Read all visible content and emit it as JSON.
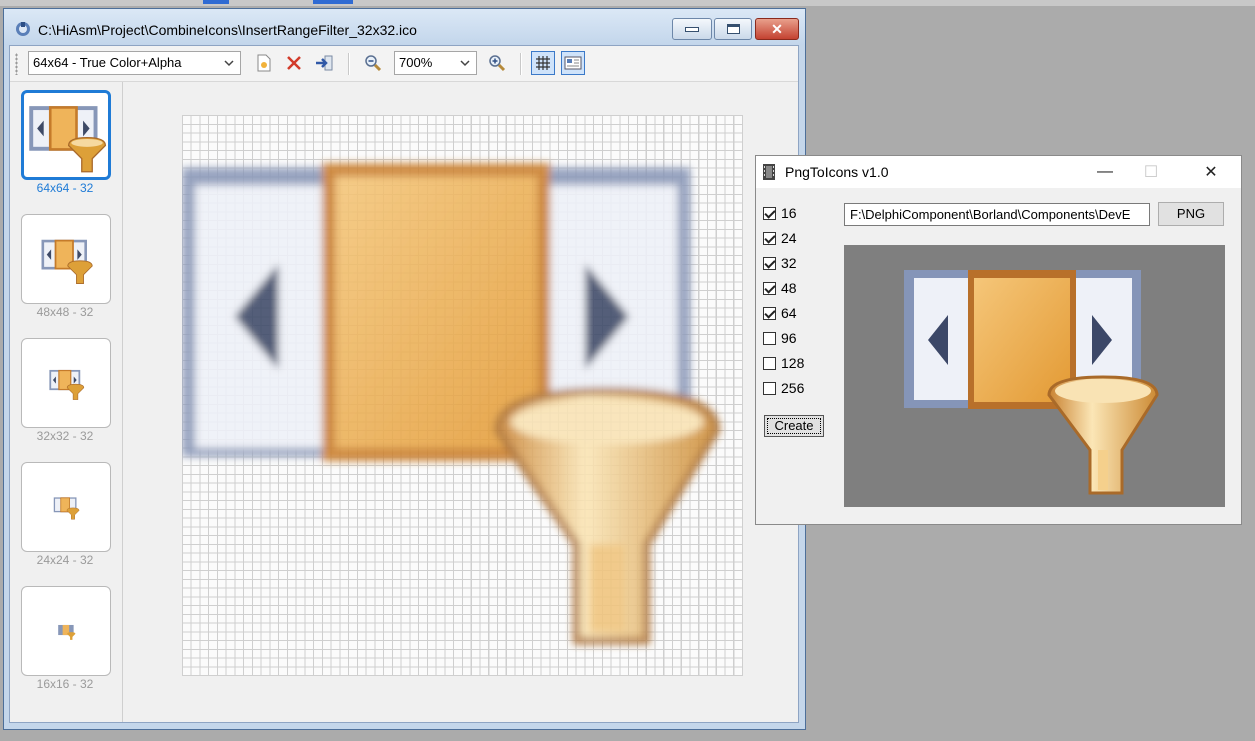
{
  "main_window": {
    "title": "C:\\HiAsm\\Project\\CombineIcons\\InsertRangeFilter_32x32.ico",
    "close_glyph": "✕",
    "toolbar": {
      "format_select": "64x64 - True Color+Alpha",
      "zoom_select": "700%",
      "icons": [
        "new-icon",
        "delete-icon",
        "import-icon",
        "zoom-out-icon",
        "zoom-in-icon",
        "grid-icon",
        "preview-icon"
      ]
    },
    "thumbnails": [
      {
        "label": "64x64 - 32",
        "selected": true
      },
      {
        "label": "48x48 - 32",
        "selected": false
      },
      {
        "label": "32x32 - 32",
        "selected": false
      },
      {
        "label": "24x24 - 32",
        "selected": false
      },
      {
        "label": "16x16 - 32",
        "selected": false
      }
    ]
  },
  "png_window": {
    "title": "PngToIcons v1.0",
    "min_glyph": "—",
    "max_glyph": "☐",
    "close_glyph": "✕",
    "sizes": [
      {
        "label": "16",
        "checked": true
      },
      {
        "label": "24",
        "checked": true
      },
      {
        "label": "32",
        "checked": true
      },
      {
        "label": "48",
        "checked": true
      },
      {
        "label": "64",
        "checked": true
      },
      {
        "label": "96",
        "checked": false
      },
      {
        "label": "128",
        "checked": false
      },
      {
        "label": "256",
        "checked": false
      }
    ],
    "path_value": "F:\\DelphiComponent\\Borland\\Components\\DevE",
    "png_button": "PNG",
    "create_button": "Create"
  },
  "colors": {
    "accent": "#1f7bd6",
    "icon_orange": "#e8a43c",
    "icon_frame": "#7d8db0",
    "preview_bg": "#7f7f7f"
  }
}
